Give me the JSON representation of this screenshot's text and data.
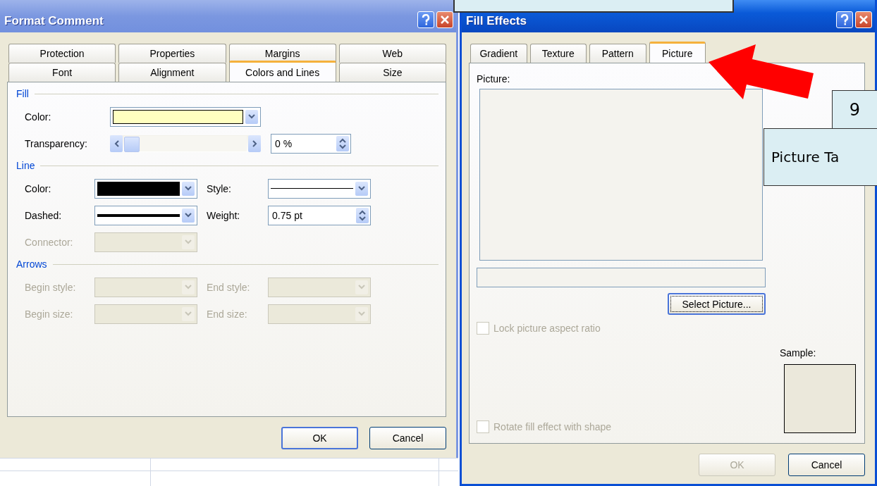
{
  "format_comment": {
    "title": "Format Comment",
    "tab_rows": [
      [
        {
          "label": "Protection",
          "selected": false
        },
        {
          "label": "Properties",
          "selected": false
        },
        {
          "label": "Margins",
          "selected": false
        },
        {
          "label": "Web",
          "selected": false
        }
      ],
      [
        {
          "label": "Font",
          "selected": false
        },
        {
          "label": "Alignment",
          "selected": false
        },
        {
          "label": "Colors and Lines",
          "selected": true
        },
        {
          "label": "Size",
          "selected": false
        }
      ]
    ],
    "sections": [
      {
        "heading": "Fill",
        "rows": [
          [
            {
              "kind": "color",
              "label": "Color:",
              "disabled": false,
              "color": "#ffffc0"
            }
          ],
          [
            {
              "kind": "slider",
              "label": "Transparency:",
              "disabled": false,
              "level": 0,
              "reading": "0 %"
            }
          ]
        ]
      },
      {
        "heading": "Line",
        "rows": [
          [
            {
              "kind": "color",
              "label": "Color:",
              "disabled": false,
              "color": "#000000"
            },
            {
              "kind": "line",
              "label": "Style:",
              "disabled": false
            }
          ],
          [
            {
              "kind": "heavyline",
              "label": "Dashed:",
              "disabled": false
            },
            {
              "kind": "spin",
              "label": "Weight:",
              "disabled": false,
              "value": "0.75 pt"
            }
          ],
          [
            {
              "kind": "empty",
              "label": "Connector:",
              "disabled": true
            }
          ]
        ]
      },
      {
        "heading": "Arrows",
        "rows": [
          [
            {
              "kind": "empty",
              "label": "Begin style:",
              "disabled": true
            },
            {
              "kind": "empty",
              "label": "End style:",
              "disabled": true
            }
          ],
          [
            {
              "kind": "empty",
              "label": "Begin size:",
              "disabled": true
            },
            {
              "kind": "empty",
              "label": "End size:",
              "disabled": true
            }
          ]
        ]
      }
    ],
    "buttons": [
      {
        "label": "OK",
        "default": true,
        "disabled": false
      },
      {
        "label": "Cancel",
        "default": false,
        "disabled": false
      }
    ]
  },
  "fill_effects": {
    "title": "Fill Effects",
    "tabs": [
      {
        "label": "Gradient",
        "selected": false
      },
      {
        "label": "Texture",
        "selected": false
      },
      {
        "label": "Pattern",
        "selected": false
      },
      {
        "label": "Picture",
        "selected": true
      }
    ],
    "picture_label": "Picture:",
    "select_button": {
      "label": "Select Picture...",
      "focused": true
    },
    "checkboxes": [
      {
        "label": "Lock picture aspect ratio",
        "checked": false,
        "disabled": true
      },
      {
        "label": "Rotate fill effect with shape",
        "checked": false,
        "disabled": true
      }
    ],
    "sample_label": "Sample:",
    "buttons": [
      {
        "label": "OK",
        "default": false,
        "disabled": true
      },
      {
        "label": "Cancel",
        "default": false,
        "disabled": false
      }
    ]
  },
  "callouts": [
    {
      "text": "9"
    },
    {
      "text": "Picture Ta"
    }
  ]
}
